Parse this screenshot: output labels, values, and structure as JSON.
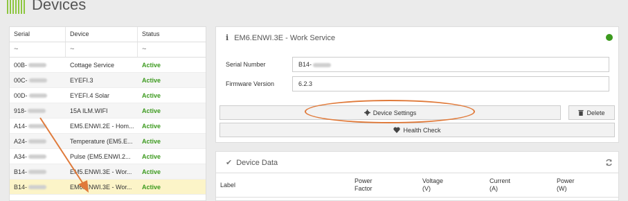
{
  "header": {
    "title": "Devices"
  },
  "table": {
    "headers": [
      "Serial",
      "Device",
      "Status"
    ],
    "filter_symbol": "~",
    "rows": [
      {
        "serial": "00B-",
        "device": "Cottage Service",
        "status": "Active"
      },
      {
        "serial": "00C-",
        "device": "EYEFI.3",
        "status": "Active"
      },
      {
        "serial": "00D-",
        "device": "EYEFI.4 Solar",
        "status": "Active"
      },
      {
        "serial": "918-",
        "device": "15A ILM.WIFI",
        "status": "Active"
      },
      {
        "serial": "A14-",
        "device": "EM5.ENWI.2E - Hom...",
        "status": "Active"
      },
      {
        "serial": "A24-",
        "device": "Temperature (EM5.E...",
        "status": "Active"
      },
      {
        "serial": "A34-",
        "device": "Pulse (EM5.ENWI.2...",
        "status": "Active"
      },
      {
        "serial": "B14-",
        "device": "EM5.ENWI.3E - Wor...",
        "status": "Active"
      },
      {
        "serial": "B14-",
        "device": "EM6.ENWI.3E - Wor...",
        "status": "Active"
      }
    ]
  },
  "info": {
    "title": "EM6.ENWI.3E - Work Service",
    "serial_label": "Serial Number",
    "serial_value": "B14-",
    "firmware_label": "Firmware Version",
    "firmware_value": "6.2.3",
    "settings_button": "Device Settings",
    "delete_button": "Delete",
    "health_button": "Health Check"
  },
  "data": {
    "title": "Device Data",
    "columns": {
      "label": "Label",
      "power_factor": [
        "Power",
        "Factor"
      ],
      "voltage": [
        "Voltage",
        "(V)"
      ],
      "current": [
        "Current",
        "(A)"
      ],
      "power": [
        "Power",
        "(W)"
      ]
    }
  },
  "colors": {
    "accent": "#8dc63f",
    "active": "#3c9a1e",
    "highlight": "#e07a3a",
    "selected_row": "#fcf4c8"
  }
}
